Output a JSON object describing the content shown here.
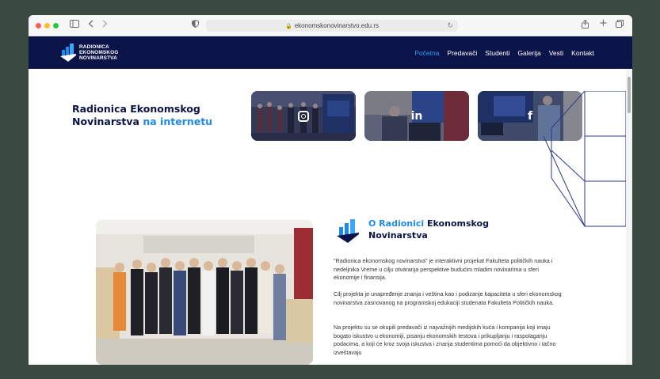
{
  "browser": {
    "url": "ekonomskonovinarstvo.edu.rs",
    "icons": [
      "sidebar-icon",
      "back-icon",
      "forward-icon",
      "shield-icon",
      "lock-icon",
      "reload-icon",
      "share-icon",
      "new-tab-icon",
      "tabs-icon"
    ]
  },
  "logo": {
    "line1": "RADIONICA",
    "line2": "EKONOMSKOG",
    "line3": "NOVINARSTVA"
  },
  "nav": {
    "items": [
      {
        "label": "Početna",
        "active": true
      },
      {
        "label": "Predavači",
        "active": false
      },
      {
        "label": "Studenti",
        "active": false
      },
      {
        "label": "Galerija",
        "active": false
      },
      {
        "label": "Vesti",
        "active": false
      },
      {
        "label": "Kontakt",
        "active": false
      }
    ]
  },
  "internet": {
    "title_main": "Radionica Ekonomskog Novinarstva",
    "title_highlight": "na internetu"
  },
  "social": [
    {
      "name": "instagram",
      "icon": "instagram-icon",
      "glyph": ""
    },
    {
      "name": "linkedin",
      "icon": "linkedin-icon",
      "glyph": "in"
    },
    {
      "name": "facebook",
      "icon": "facebook-icon",
      "glyph": "f"
    }
  ],
  "about": {
    "title_highlight": "O Radionici",
    "title_rest": "Ekonomskog Novinarstva",
    "paragraphs": [
      "\"Radionica ekonomskog novinarstva\" je interaktivni projekat Fakulteta političkih nauka i nedeljnika Vreme u cilju otvaranja perspektive budućim mladim novinarima u sferi ekonomije i finansija.",
      "Cilj projekta je unapređenje znanja i veština kao i podizanje kapaciteta u sferi ekonomskog novinarstva zasnovanog na programskoj edukaciji studenata Fakulteta Političkih nauka.",
      "Na projektu su se okupili predavači iz najvažnijih medijskih kuća i kompanija koji imaju bogato iskustvo u ekonomiji, pisanju ekonomskih testova i prikupljanju i raspolaganju podacima, a koji će kroz svoja iskustva i znanja studentima pomoći da objektivno i tačno izveštavaju"
    ]
  },
  "colors": {
    "navy": "#0b1448",
    "accent": "#1d8be6",
    "nav_active": "#2d9cf4"
  }
}
